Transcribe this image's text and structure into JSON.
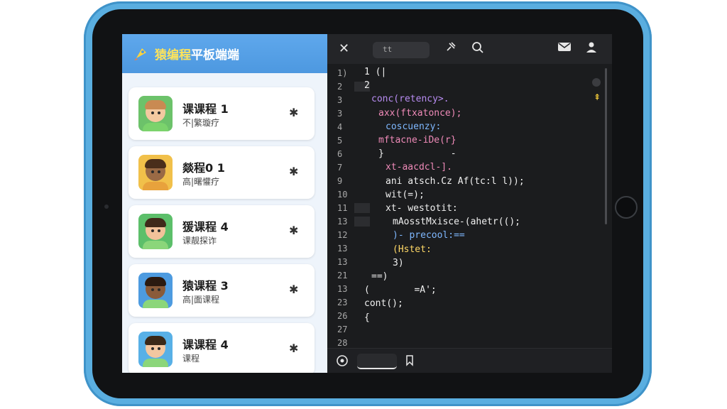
{
  "app": {
    "title_highlight": "猿编程",
    "title_rest": "平板端端"
  },
  "courses": [
    {
      "title": "课课程 1",
      "subtitle": "不|繁璇疗",
      "skin": "#f4c9a0",
      "hair": "#c98a52",
      "bg": "#6cc26a",
      "shirt": "#7bd36c"
    },
    {
      "title": "燚程0 1",
      "subtitle": "高|曙懽疗",
      "skin": "#9a6a45",
      "hair": "#4a2e1b",
      "bg": "#f1c04a",
      "shirt": "#e8a23c"
    },
    {
      "title": "猨课程 4",
      "subtitle": "课靓探诈",
      "skin": "#f2c29a",
      "hair": "#3f2a1a",
      "bg": "#5cbf6a",
      "shirt": "#8bd67a"
    },
    {
      "title": "猿课程 3",
      "subtitle": "高|面课程",
      "skin": "#8a5b3a",
      "hair": "#2b1a10",
      "bg": "#4d9be0",
      "shirt": "#8bd67a"
    },
    {
      "title": "课课程 4",
      "subtitle": "课程",
      "skin": "#f3c7a0",
      "hair": "#3a2817",
      "bg": "#58b0e6",
      "shirt": "#8bd67a"
    }
  ],
  "editor": {
    "tab_label": "tt",
    "line_numbers": [
      "1)",
      "2",
      "3",
      "3",
      "4",
      "5",
      "6",
      "7",
      "9",
      "10",
      "11",
      "13",
      "12",
      "13",
      "13",
      "21",
      "13",
      "23",
      "26",
      "27",
      "28"
    ],
    "code_lines": [
      {
        "text": "1 (|",
        "color": "white",
        "indent": 0
      },
      {
        "text": "2",
        "color": "white",
        "indent": 0
      },
      {
        "text": "conc(retency>.",
        "color": "purple",
        "indent": 1
      },
      {
        "text": "axx(ftxatonce);",
        "color": "pink",
        "indent": 2
      },
      {
        "text": "coscuenzy:",
        "color": "blue",
        "indent": 3
      },
      {
        "text": "mftacne-iDe(r}",
        "color": "pink",
        "indent": 2
      },
      {
        "text": "}            -",
        "color": "white",
        "indent": 2
      },
      {
        "text": "xt-aacdcl-].",
        "color": "pink",
        "indent": 3
      },
      {
        "text": "ani atsch.Cz Af(tc:l l));",
        "color": "white",
        "indent": 3
      },
      {
        "text": "wit(=);",
        "color": "white",
        "indent": 3
      },
      {
        "text": "xt- westotit:",
        "color": "white",
        "indent": 3
      },
      {
        "text": "mAosstMxisce-(ahetr(();",
        "color": "white",
        "indent": 4
      },
      {
        "text": ")- precool:==",
        "color": "blue",
        "indent": 4
      },
      {
        "text": "(Hstet:",
        "color": "yellow",
        "indent": 4
      },
      {
        "text": "3)",
        "color": "white",
        "indent": 4
      },
      {
        "text": "==)",
        "color": "white",
        "indent": 1
      },
      {
        "text": "(        =A';",
        "color": "white",
        "indent": 0
      },
      {
        "text": "cont();",
        "color": "white",
        "indent": 0
      },
      {
        "text": "{",
        "color": "white",
        "indent": 0
      }
    ]
  }
}
